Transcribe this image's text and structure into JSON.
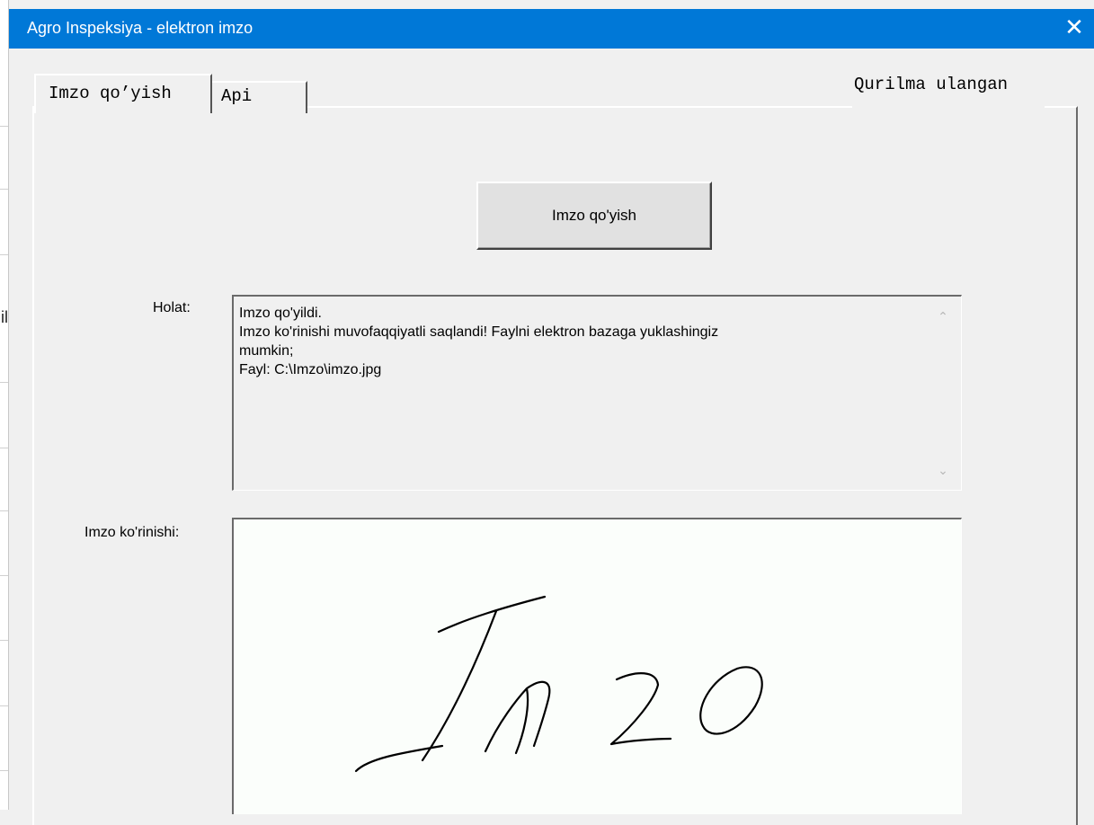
{
  "window": {
    "title": "Agro Inspeksiya - elektron imzo",
    "close_glyph": "✕"
  },
  "tabs": [
    {
      "label": "Imzo qo’yish",
      "active": true
    },
    {
      "label": "Api",
      "active": false
    }
  ],
  "device_status": "Qurilma ulangan",
  "sign_button_label": "Imzo qo'yish",
  "status": {
    "label": "Holat:",
    "lines": [
      "Imzo qo'yildi.",
      "Imzo ko'rinishi muvofaqqiyatli saqlandi! Faylni elektron bazaga yuklashingiz",
      "mumkin;",
      "Fayl: C:\\Imzo\\imzo.jpg"
    ]
  },
  "signature": {
    "label": "Imzo ko'rinishi:",
    "image_text": "Imzo"
  },
  "background_fragment": "il",
  "icons": {
    "close": "close-icon",
    "scroll_up": "scroll-up-arrow-icon",
    "scroll_down": "scroll-down-arrow-icon"
  },
  "colors": {
    "titlebar": "#0078d7",
    "window_bg": "#f0f0f0",
    "signature_bg": "#fbfefb"
  }
}
